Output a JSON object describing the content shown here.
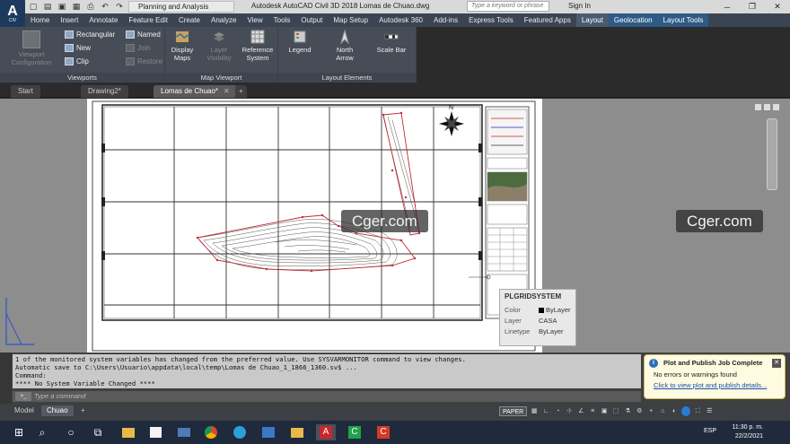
{
  "app": {
    "logo_text": "A",
    "logo_sub": "CIV",
    "workspace": "Planning and Analysis",
    "title": "Autodesk AutoCAD Civil 3D 2018    Lomas de Chuao.dwg",
    "search_placeholder": "Type a keyword or phrase",
    "signin": "Sign In"
  },
  "ribbon_tabs": [
    "Home",
    "Insert",
    "Annotate",
    "Feature Edit",
    "Create",
    "Analyze",
    "View",
    "Tools",
    "Output",
    "Map Setup",
    "Autodesk 360",
    "Add-ins",
    "Express Tools",
    "Featured Apps",
    "Layout",
    "Geolocation",
    "Layout Tools"
  ],
  "ribbon_active_tab": "Layout",
  "ribbon": {
    "viewports": {
      "title": "Viewports",
      "viewport_config": "Viewport Configuration",
      "rectangular": "Rectangular",
      "new": "New",
      "clip": "Clip",
      "named": "Named",
      "join": "Join",
      "restore": "Restore"
    },
    "map_viewport": {
      "title": "Map Viewport",
      "display_maps": "Display Maps",
      "layer_visibility": "Layer Visibility",
      "reference_system": "Reference System"
    },
    "layout_elements": {
      "title": "Layout Elements",
      "legend": "Legend",
      "north_arrow": "North Arrow",
      "scale_bar": "Scale Bar"
    }
  },
  "doc_tabs": [
    {
      "label": "Start"
    },
    {
      "label": "Drawing2*"
    },
    {
      "label": "Lomas de Chuao*"
    }
  ],
  "watermarks": [
    "Cger.com",
    "Cger.com"
  ],
  "tooltip": {
    "title": "PLGRIDSYSTEM",
    "rows": [
      {
        "key": "Color",
        "value": "ByLayer"
      },
      {
        "key": "Layer",
        "value": "CASA"
      },
      {
        "key": "Linetype",
        "value": "ByLayer"
      }
    ]
  },
  "north_label": "N",
  "command_history": [
    "1 of the monitored system variables has changed from the preferred value. Use SYSVARMONITOR command to view changes.",
    "Automatic save to C:\\Users\\Usuario\\appdata\\local\\temp\\Lomas de Chuao_1_1866_1360.sv$ ...",
    "Command:",
    "**** No System Variable Changed ****"
  ],
  "command_placeholder": "Type a command",
  "notification": {
    "title": "Plot and Publish Job Complete",
    "line": "No errors or warnings found",
    "link": "Click to view plot and publish details..."
  },
  "layout_tabs": [
    "Model",
    "Chuao"
  ],
  "status": {
    "paper": "PAPER"
  },
  "taskbar": {
    "lang": "ESP",
    "time": "11:30 p. m.",
    "date": "22/2/2021"
  }
}
